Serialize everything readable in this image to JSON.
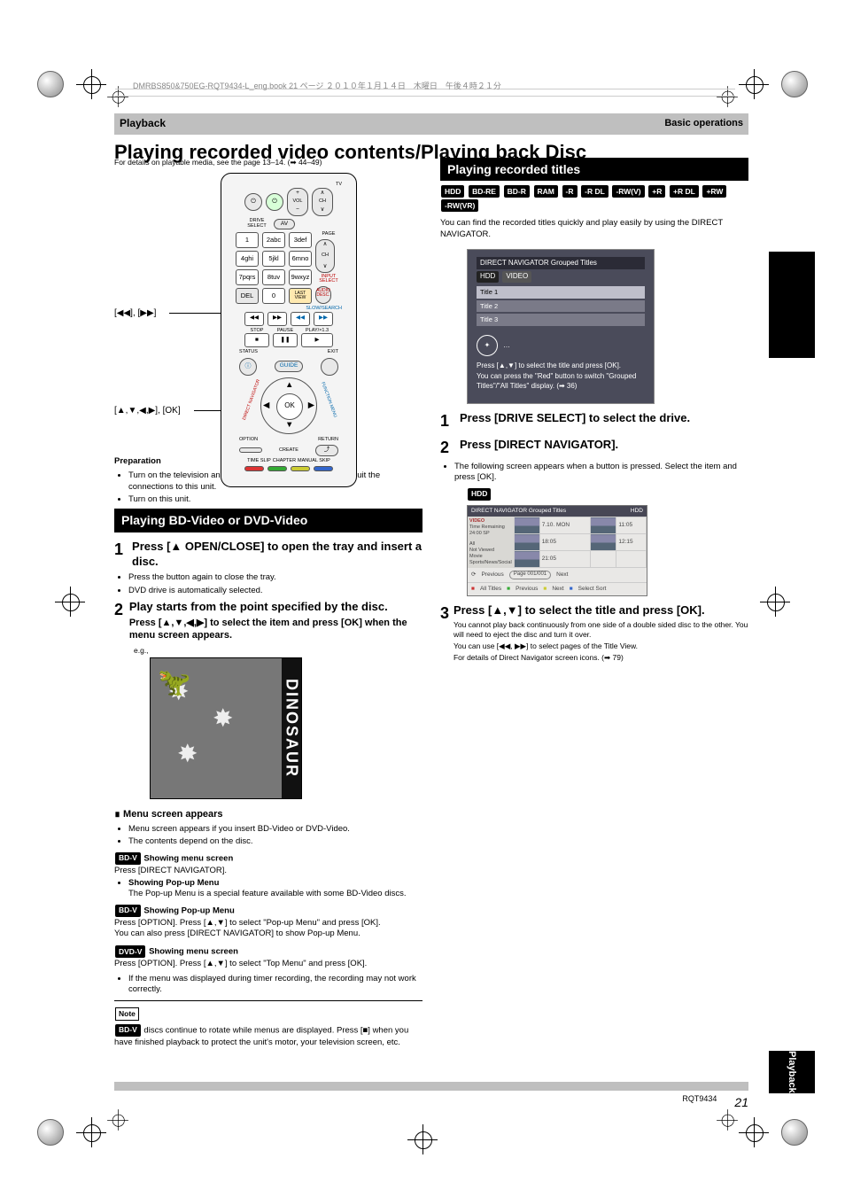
{
  "header": {
    "filename": "DMRBS850&750EG-RQT9434-L_eng.book 21 ページ ２０１０年１月１４日　木曜日　午後４時２１分"
  },
  "grey_header_row": {
    "left": "Playback",
    "right": "Basic operations"
  },
  "main_title": "Playing recorded video contents/Playing back Disc",
  "left": {
    "intro": "For details on playable media, see the page 13–14. (➡ 44–49)",
    "remote": {
      "tv_label": "TV",
      "drive_select": "DRIVE SELECT",
      "av": "AV",
      "vol": "VOL",
      "ch": "CH",
      "page": "PAGE",
      "numbers": [
        "1",
        "2abc",
        "3def",
        "4ghi",
        "5jkl",
        "6mno",
        "7pqrs",
        "8tuv",
        "9wxyz",
        "0"
      ],
      "del": "DEL",
      "last_view": "LAST VIEW",
      "input_select": "INPUT SELECT",
      "audio_desc": "AUDIO DESC.",
      "slow_search": "SLOW/SEARCH",
      "stop": "STOP",
      "pause": "PAUSE",
      "play": "PLAY/×1.3",
      "status": "STATUS",
      "exit": "EXIT",
      "guide": "GUIDE",
      "direct_nav": "DIRECT NAVIGATOR",
      "function_menu": "FUNCTION MENU",
      "ok": "OK",
      "option": "OPTION",
      "return": "RETURN",
      "create": "CREATE",
      "time_slip": "TIME SLIP",
      "chapter": "CHAPTER",
      "manual_skip": "MANUAL SKIP"
    },
    "callouts": {
      "skip": "[◀◀], [▶▶]",
      "arrows_ok": "[▲,▼,◀,▶], [OK]"
    },
    "prep": {
      "title": "Preparation",
      "b1": "Turn on the television and select the appropriate AV input to suit the connections to this unit.",
      "b2": "Turn on this unit."
    },
    "bdv_heading": "Playing BD-Video or DVD-Video",
    "step1": {
      "n": "1",
      "t": "Press [▲ OPEN/CLOSE] to open the tray and insert a disc."
    },
    "step1_sub1": "Press the button again to close the tray.",
    "step1_sub2": "DVD drive is automatically selected.",
    "step2": {
      "n": "2",
      "t": "Play starts from the point specified by the disc."
    },
    "step2_sub": "Press [▲,▼,◀,▶] to select the item and press [OK] when the menu screen appears.",
    "dvd_spine": "DINOSAUR",
    "menu_heading": "∎ Menu screen appears",
    "menu_footer1": "Menu screen appears if you insert BD-Video or DVD-Video.",
    "menu_footer2": "The contents depend on the disc.",
    "menu_showing": {
      "intro": "Showing menu screen",
      "press": "Press [DIRECT NAVIGATOR]."
    },
    "popup": {
      "title": "Showing Pop-up Menu",
      "line1": "The Pop-up Menu is a special feature available with some BD-Video discs.",
      "line2": "Press [OPTION]. Press [▲,▼] to select \"Pop-up Menu\" and press [OK].",
      "line3": "You can also press [DIRECT NAVIGATOR] to show Pop-up Menu."
    },
    "top_menu": {
      "line": "Press [OPTION]. Press [▲,▼] to select \"Top Menu\" and press [OK]."
    },
    "final_bullet": "If the menu was displayed during timer recording, the recording may not work correctly.",
    "note_label": "Note",
    "note_text": "discs continue to rotate while menus are displayed. Press [■] when you have finished playback to protect the unit's motor, your television screen, etc."
  },
  "right": {
    "heading": "Playing recorded titles",
    "discs": [
      "HDD",
      "BD-RE",
      "BD-R",
      "RAM",
      "-R",
      "-R DL",
      "-RW(V)",
      "+R",
      "+R DL",
      "+RW",
      "-RW(VR)"
    ],
    "intro": "You can find the recorded titles quickly and play easily by using the DIRECT NAVIGATOR.",
    "tv": {
      "top": "DIRECT NAVIGATOR Grouped Titles",
      "hdd": "HDD",
      "video": "VIDEO",
      "rows": [
        "Title 1",
        "Title 2",
        "Title 3"
      ],
      "hint1": "Press [▲,▼] to select the title and press [OK].",
      "hint2": "You can press the \"Red\" button to switch \"Grouped Titles\"/\"All Titles\" display. (➡ 36)"
    },
    "step1": {
      "n": "1",
      "t": "Press [DRIVE SELECT] to select the drive."
    },
    "step2": {
      "n": "2",
      "t": "Press [DIRECT NAVIGATOR]."
    },
    "step2_bullet": "The following screen appears when a button is pressed. Select the item and press [OK].",
    "hdd_badge": "HDD",
    "grid": {
      "top_left": "DIRECT NAVIGATOR   Grouped Titles",
      "top_right": "HDD",
      "side_labels": [
        "VIDEO",
        "Time Remaining  24:00 SP",
        "Not Viewed",
        "Movie",
        "Sports/News/Social"
      ],
      "row_date": "7.10. MON",
      "row_times": [
        "11:05",
        "18:05",
        "12:15",
        "21:05"
      ],
      "footer": [
        "Previous",
        "Page 001/001",
        "Next"
      ],
      "footer_btns": [
        "All Titles",
        "Previous",
        "Next",
        "Select Sort"
      ]
    },
    "step3": {
      "n": "3",
      "t": "Press [▲,▼] to select the title and press [OK].",
      "sub1": "You cannot play back continuously from one side of a double sided disc to the other. You will need to eject the disc and turn it over.",
      "sub2": "You can use [◀◀, ▶▶] to select pages of the Title View.",
      "sub3": "For details of Direct Navigator screen icons. (➡ 79)"
    }
  },
  "sidebar": {
    "tab_text": "Playback"
  },
  "footer": {
    "code": "RQT9434",
    "page": "21"
  }
}
